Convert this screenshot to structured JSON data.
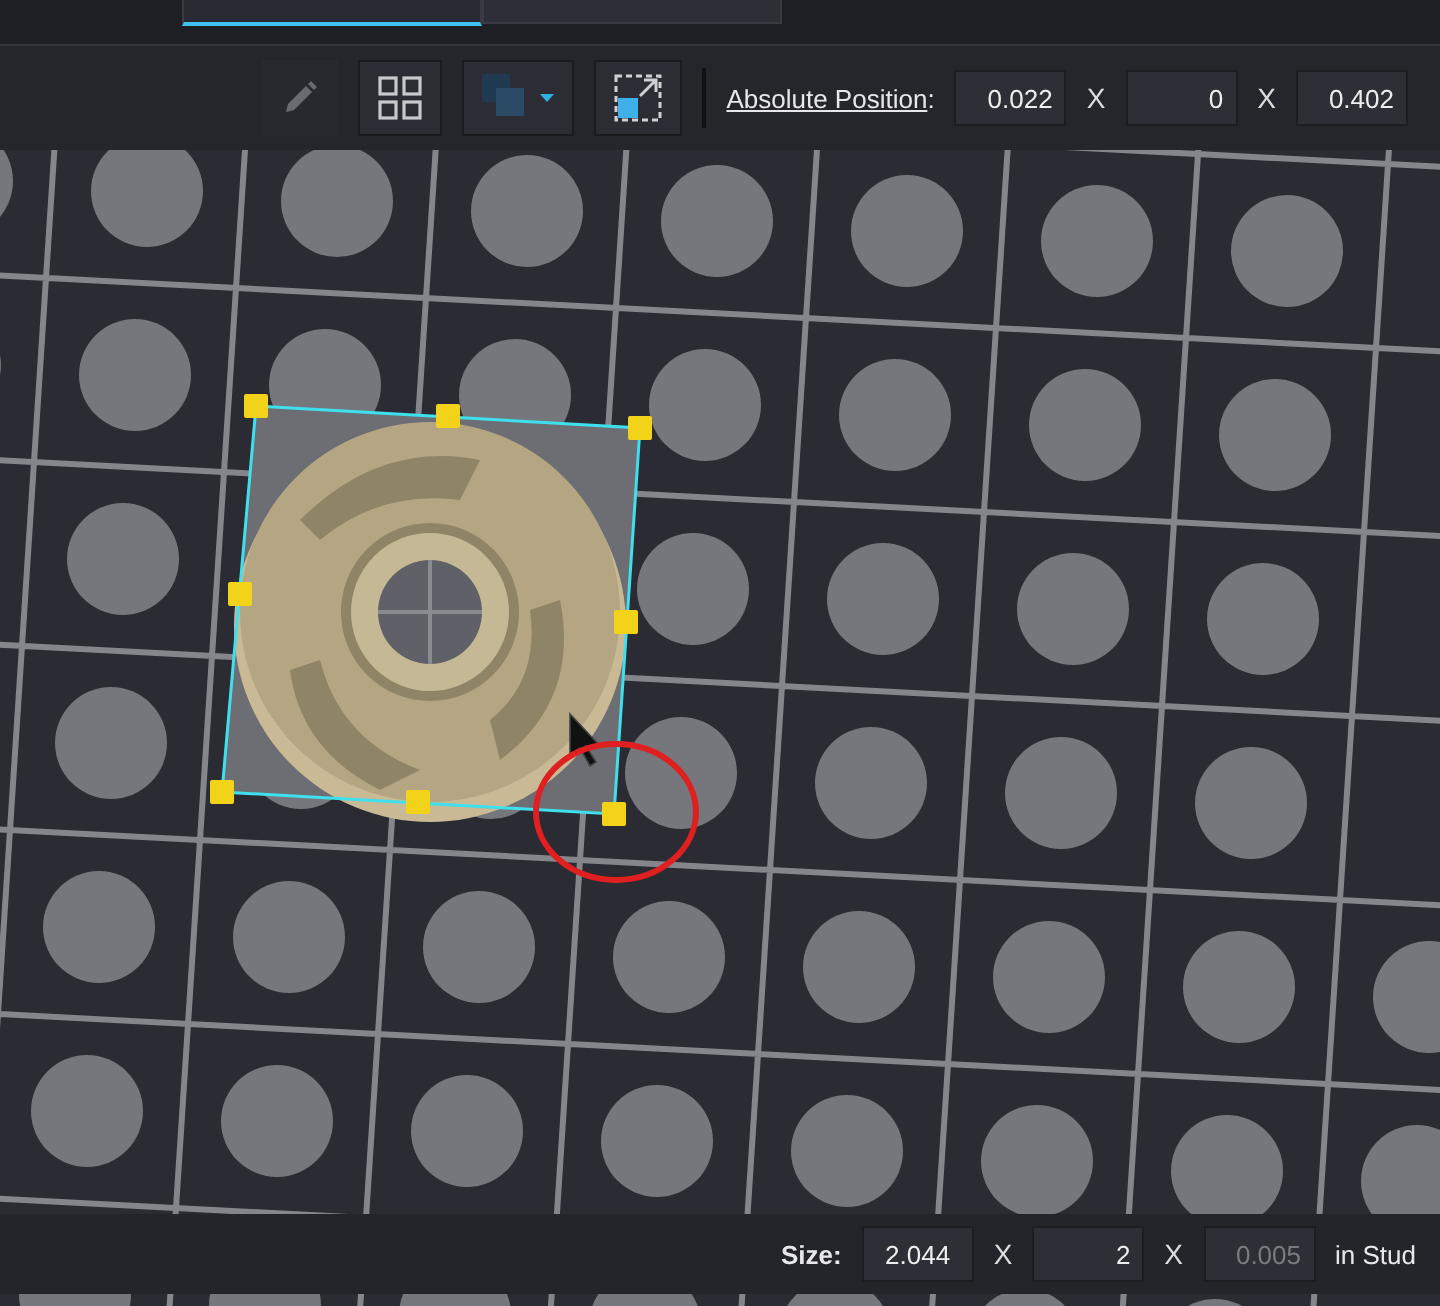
{
  "tabs": [
    {
      "selected": true
    },
    {
      "selected": false
    }
  ],
  "toolbar": {
    "tools": [
      {
        "kind": "pencil",
        "disabled": true
      },
      {
        "kind": "grid",
        "disabled": false
      },
      {
        "kind": "color",
        "disabled": false
      },
      {
        "kind": "resize",
        "disabled": false
      }
    ],
    "position_label": "Absolute Position",
    "position_sep": ":",
    "position": [
      {
        "value": "0.022"
      },
      {
        "sep": "X",
        "value": "0"
      },
      {
        "sep": "X",
        "value": "0.402"
      }
    ]
  },
  "size_bar": {
    "label": "Size:",
    "values": [
      {
        "value": "2.044",
        "disabled": false
      },
      {
        "sep": "X",
        "value": "2",
        "disabled": false
      },
      {
        "sep": "X",
        "value": "0.005",
        "disabled": true
      }
    ],
    "unit": "in Stud"
  }
}
